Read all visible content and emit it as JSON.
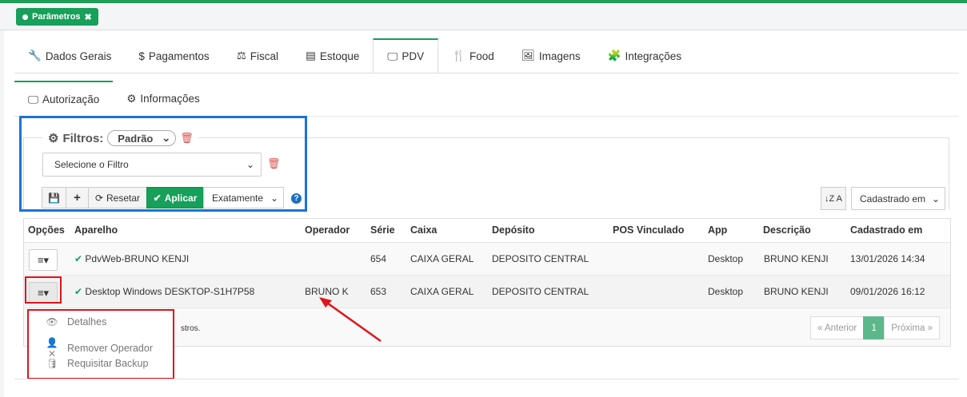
{
  "top_chip": {
    "label": "Parâmetros",
    "close": "✖"
  },
  "main_tabs": [
    {
      "icon": "🔧",
      "label": "Dados Gerais"
    },
    {
      "icon": "$",
      "label": "Pagamentos"
    },
    {
      "icon": "⚖",
      "label": "Fiscal"
    },
    {
      "icon": "▤",
      "label": "Estoque"
    },
    {
      "icon": "🖵",
      "label": "PDV"
    },
    {
      "icon": "🍴",
      "label": "Food"
    },
    {
      "icon": "🖼",
      "label": "Imagens"
    },
    {
      "icon": "🧩",
      "label": "Integrações"
    }
  ],
  "sub_tabs": [
    {
      "icon": "🖵",
      "label": "Autorização"
    },
    {
      "icon": "⚙",
      "label": "Informações"
    }
  ],
  "filters": {
    "title": "Filtros:",
    "preset": "Padrão",
    "select_placeholder": "Selecione o Filtro",
    "reset_label": "Resetar",
    "apply_label": "Aplicar",
    "match_mode": "Exatamente",
    "help": "?"
  },
  "sort": {
    "field": "Cadastrado em",
    "icon_label": "↓Z A"
  },
  "table": {
    "headers": [
      "Opções",
      "Aparelho",
      "Operador",
      "Série",
      "Caixa",
      "Depósito",
      "POS Vinculado",
      "App",
      "Descrição",
      "Cadastrado em"
    ],
    "rows": [
      {
        "device": "PdvWeb-BRUNO KENJI",
        "operator": "",
        "serie": "654",
        "caixa": "CAIXA GERAL",
        "deposito": "DEPOSITO CENTRAL",
        "pos": "",
        "app": "Desktop",
        "descricao": "BRUNO KENJI",
        "cadastrado": "13/01/2026 14:34"
      },
      {
        "device": "Desktop Windows DESKTOP-S1H7P58",
        "operator": "BRUNO K",
        "serie": "653",
        "caixa": "CAIXA GERAL",
        "deposito": "DEPOSITO CENTRAL",
        "pos": "",
        "app": "Desktop",
        "descricao": "BRUNO KENJI",
        "cadastrado": "09/01/2026 16:12"
      }
    ],
    "records_text": "stros.",
    "pagination": {
      "prev": "« Anterior",
      "current": "1",
      "next": "Próxima »"
    }
  },
  "context_menu": {
    "items": [
      {
        "icon": "eye-icon",
        "label": "Detalhes"
      },
      {
        "icon": "user-remove-icon",
        "label": "Remover Operador"
      },
      {
        "icon": "database-icon",
        "label": "Requisitar Backup"
      }
    ]
  },
  "colors": {
    "accent": "#16a05a",
    "annotation_red": "#e0141a",
    "annotation_blue": "#1a73d8"
  }
}
